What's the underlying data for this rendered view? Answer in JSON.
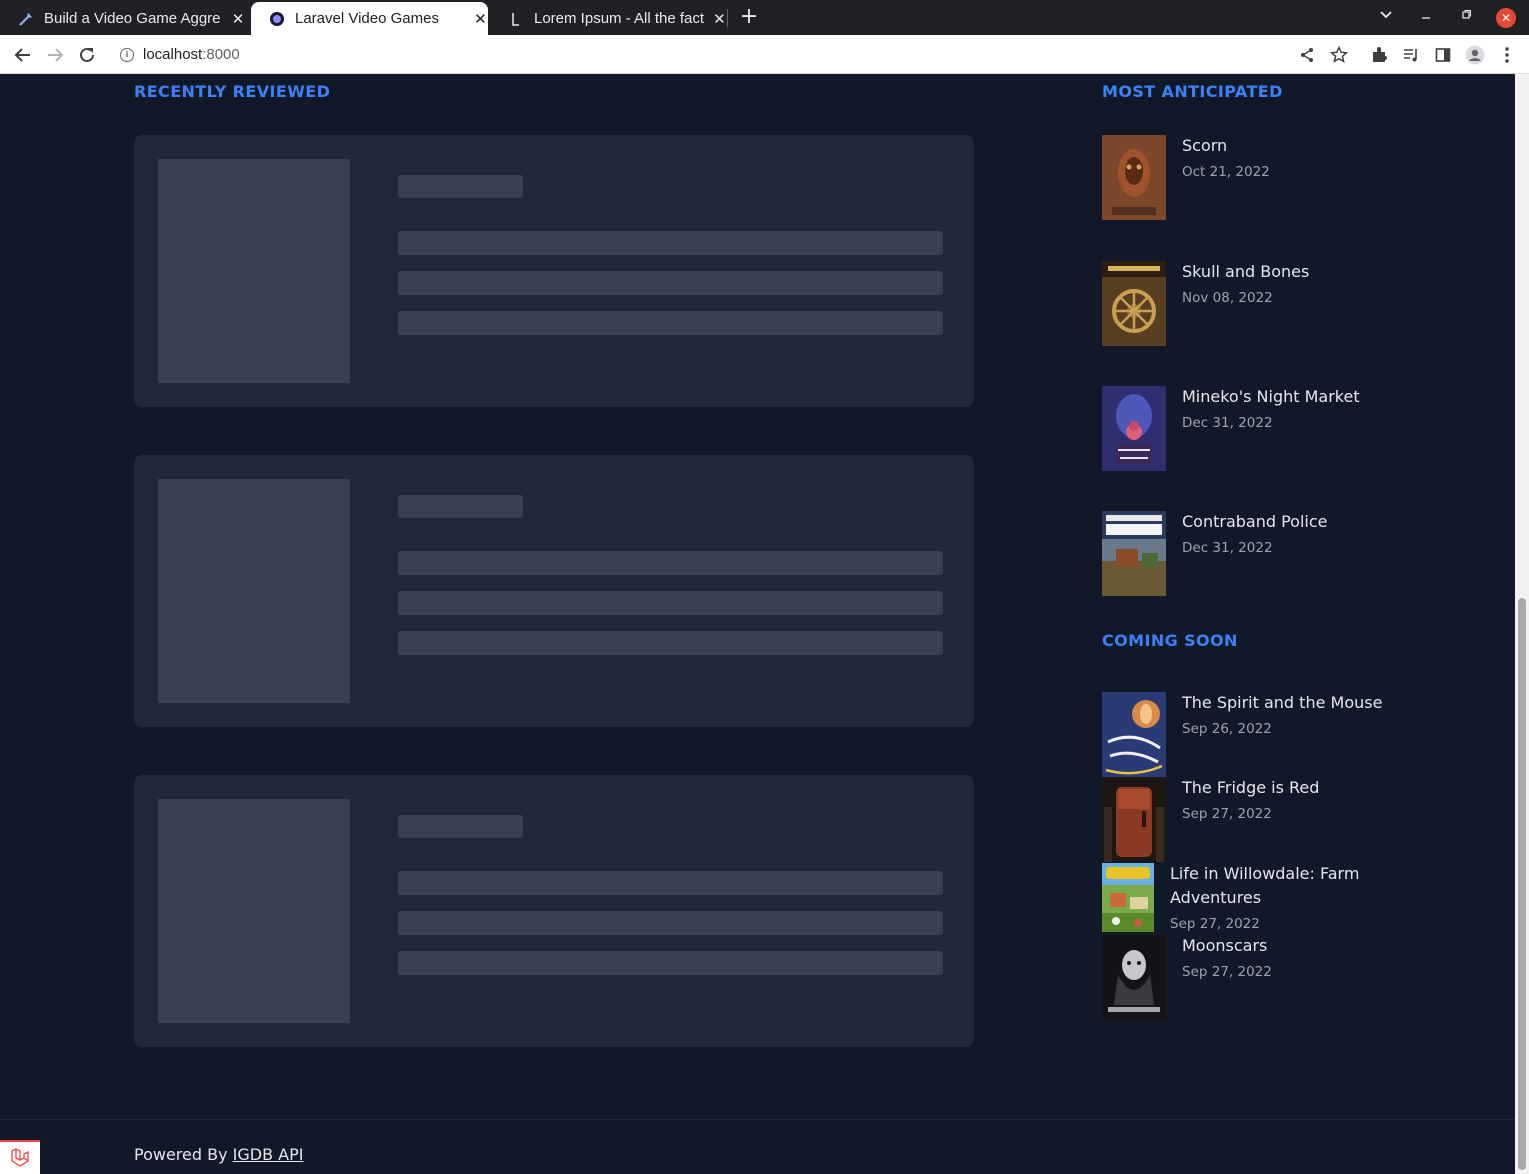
{
  "browser": {
    "tabs": [
      {
        "title": "Build a Video Game Aggre",
        "icon": "tools-icon",
        "active": false
      },
      {
        "title": "Laravel Video Games",
        "icon": "globe-icon",
        "active": true
      },
      {
        "title": "Lorem Ipsum - All the fact",
        "icon": "lipsum-icon",
        "active": false
      }
    ],
    "url_host": "localhost",
    "url_port": ":8000"
  },
  "main": {
    "recently_reviewed_heading": "Recently Reviewed",
    "skeleton_cards": 3
  },
  "sidebar": {
    "most_anticipated_heading": "Most Anticipated",
    "most_anticipated": [
      {
        "name": "Scorn",
        "date": "Oct 21, 2022",
        "cover_color": "#7a4a2a"
      },
      {
        "name": "Skull and Bones",
        "date": "Nov 08, 2022",
        "cover_color": "#6b4a24"
      },
      {
        "name": "Mineko's Night Market",
        "date": "Dec 31, 2022",
        "cover_color": "#3b3f8f"
      },
      {
        "name": "Contraband Police",
        "date": "Dec 31, 2022",
        "cover_color": "#5c5a3a"
      }
    ],
    "coming_soon_heading": "Coming Soon",
    "coming_soon": [
      {
        "name": "The Spirit and the Mouse",
        "date": "Sep 26, 2022",
        "cover_color": "#2f3f7a"
      },
      {
        "name": "The Fridge is Red",
        "date": "Sep 27, 2022",
        "cover_color": "#5a2a1e"
      },
      {
        "name": "Life in Willowdale: Farm Adventures",
        "date": "Sep 27, 2022",
        "cover_color": "#6b8a3a"
      },
      {
        "name": "Moonscars",
        "date": "Sep 27, 2022",
        "cover_color": "#1e1e22"
      }
    ]
  },
  "footer": {
    "powered_by": "Powered By",
    "link_text": "IGDB API"
  }
}
